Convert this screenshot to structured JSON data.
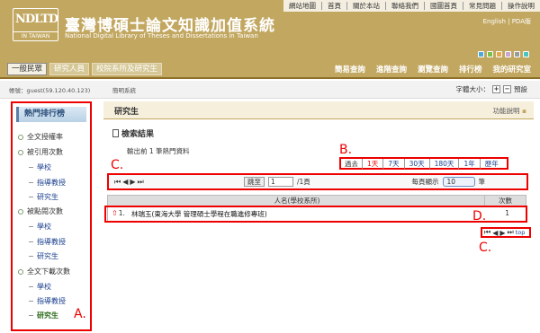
{
  "header": {
    "logo_text": "NDLTD",
    "logo_sub": "IN TAIWAN",
    "title": "臺灣博碩士論文知識加值系統",
    "subtitle": "National Digital Library of Theses and Dissertations in Taiwan",
    "top_links": [
      "網站地圖",
      "首頁",
      "關於本站",
      "聯絡我們",
      "國圖首頁",
      "常見問題",
      "操作說明"
    ],
    "lang_links": "English | PDA版",
    "swatch_colors": [
      "#4fa8d8",
      "#7bbf4e",
      "#e9a74a",
      "#c8a7d8",
      "#9a9a9a",
      "#4bc3c0"
    ]
  },
  "nav": {
    "user_tabs": [
      "一般民眾",
      "研究人員",
      "校院系所及研究生"
    ],
    "menu": [
      "簡易查詢",
      "進階查詢",
      "瀏覽查詢",
      "排行榜",
      "我的研究室"
    ]
  },
  "info": {
    "account": "帳號：guest(59.120.40.123)",
    "breadcrumb": "簡明系統",
    "font_label": "字體大小：",
    "font_plus": "+",
    "font_minus": "−",
    "font_reset": "預設"
  },
  "sidebar": {
    "title": "熱門排行榜",
    "items": [
      {
        "label": "全文授權率"
      },
      {
        "label": "被引用次數"
      },
      {
        "label": "學校"
      },
      {
        "label": "指導教授"
      },
      {
        "label": "研究生"
      },
      {
        "label": "被點閱次數"
      },
      {
        "label": "學校"
      },
      {
        "label": "指導教授"
      },
      {
        "label": "研究生"
      },
      {
        "label": "全文下載次數"
      },
      {
        "label": "學校"
      },
      {
        "label": "指導教授"
      },
      {
        "label": "研究生"
      }
    ]
  },
  "main": {
    "section_title": "研究生",
    "help": "功能說明",
    "result_title": "檢索結果",
    "result_count": "輸出前 1 筆熱門資料",
    "period": {
      "label": "過去",
      "options": [
        "1天",
        "7天",
        "30天",
        "180天",
        "1年",
        "歷年"
      ]
    },
    "pager": {
      "goto_label": "跳至",
      "page_value": "1",
      "page_total": "/1頁",
      "per_page_label": "每頁顯示",
      "per_page_value": "10",
      "per_page_unit": "筆"
    },
    "table": {
      "headers": [
        "人名(學校系所)",
        "次數"
      ],
      "rows": [
        {
          "rank": "1.",
          "name": "林瑞玉(東海大學 管理碩士學程在職進修專班)",
          "count": "1"
        }
      ]
    },
    "top_link": "top"
  },
  "markers": {
    "a": "A.",
    "b": "B.",
    "c": "C.",
    "d": "D.",
    "c2": "C."
  }
}
